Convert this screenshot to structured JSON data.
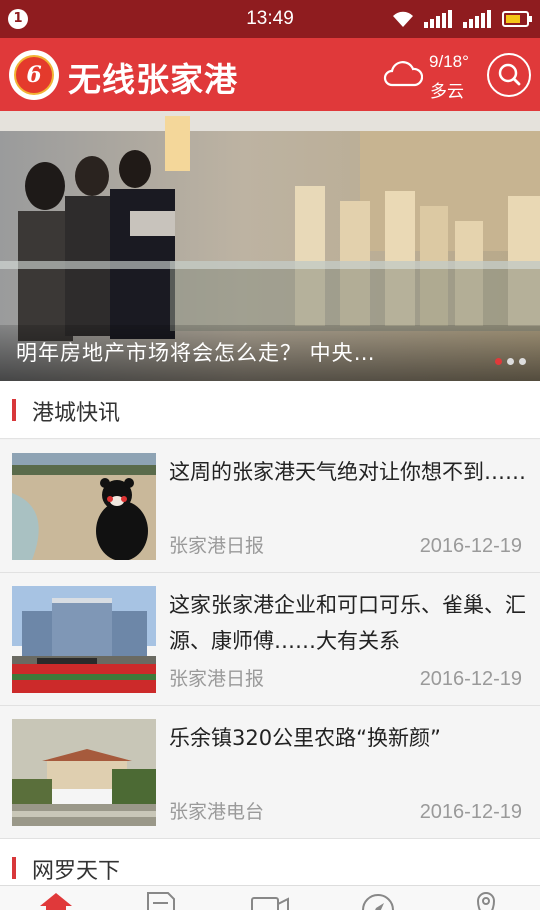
{
  "status_bar": {
    "notification_count": "1",
    "time": "13:49"
  },
  "header": {
    "app_title": "无线张家港",
    "logo_text": "6",
    "weather": {
      "temperature": "9/18°",
      "condition": "多云",
      "icon": "cloud-icon"
    },
    "search_icon": "search-icon"
  },
  "banner": {
    "caption": "明年房地产市场将会怎么走？ 中央…",
    "slide_count": 3,
    "active_slide": 1
  },
  "sections": [
    {
      "title": "港城快讯"
    },
    {
      "title": "网罗天下"
    }
  ],
  "news": [
    {
      "headline": "这周的张家港天气绝对让你想不到……",
      "source": "张家港日报",
      "date": "2016-12-19"
    },
    {
      "headline": "这家张家港企业和可口可乐、雀巢、汇源、康师傅……大有关系",
      "source": "张家港日报",
      "date": "2016-12-19"
    },
    {
      "headline": "乐余镇320公里农路“换新颜”",
      "source": "张家港电台",
      "date": "2016-12-19"
    }
  ],
  "bottom_nav": [
    {
      "icon": "home-icon",
      "active": true
    },
    {
      "icon": "document-icon",
      "active": false
    },
    {
      "icon": "video-icon",
      "active": false
    },
    {
      "icon": "compass-icon",
      "active": false
    },
    {
      "icon": "location-pin-icon",
      "active": false
    }
  ],
  "colors": {
    "brand_red": "#e0393a",
    "status_bar": "#8f1c1f",
    "accent_bar": "#d8373a"
  }
}
